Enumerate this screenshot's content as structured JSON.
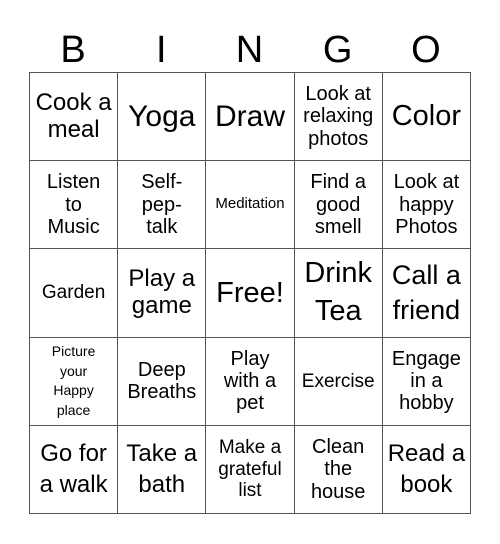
{
  "header": {
    "letters": [
      "B",
      "I",
      "N",
      "G",
      "O"
    ]
  },
  "board": {
    "rows": [
      [
        "Cook a meal",
        "Yoga",
        "Draw",
        "Look at relaxing photos",
        "Color"
      ],
      [
        "Listen to Music",
        "Self-pep-talk",
        "Meditation",
        "Find a good smell",
        "Look at happy Photos"
      ],
      [
        "Garden",
        "Play a game",
        "Free!",
        "Drink Tea",
        "Call a friend"
      ],
      [
        "Picture your Happy place",
        "Deep Breaths",
        "Play with a pet",
        "Exercise",
        "Engage in a hobby"
      ],
      [
        "Go for a walk",
        "Take a bath",
        "Make a grateful list",
        "Clean the house",
        "Read a book"
      ]
    ]
  }
}
